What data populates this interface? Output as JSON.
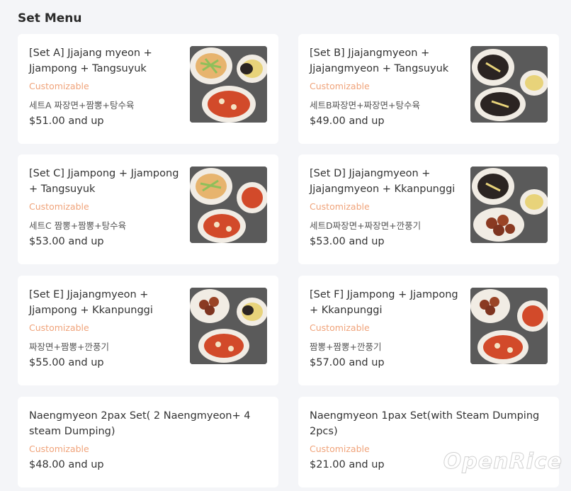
{
  "section_title": "Set Menu",
  "watermark": "OpenRice",
  "colors": {
    "customizable": "#f0a37a",
    "page_bg": "#f4f5f8",
    "card_bg": "#ffffff"
  },
  "items": [
    {
      "name": "[Set A] Jjajang myeon + Jjampong + Tangsuyuk",
      "customizable": "Customizable",
      "desc": "세트A 짜장면+짬뽕+탕수육",
      "price": "$51.00 and up",
      "photo": "set-a-photo"
    },
    {
      "name": "[Set B] Jjajangmyeon + Jjajangmyeon + Tangsuyuk",
      "customizable": "Customizable",
      "desc": "세트B짜장면+짜장면+탕수육",
      "price": "$49.00 and up",
      "photo": "set-b-photo"
    },
    {
      "name": "[Set C] Jjampong + Jjampong + Tangsuyuk",
      "customizable": "Customizable",
      "desc": "세트C 짬뽕+짬뽕+탕수육",
      "price": "$53.00 and up",
      "photo": "set-c-photo"
    },
    {
      "name": "[Set D] Jjajangmyeon + Jjajangmyeon + Kkanpunggi",
      "customizable": "Customizable",
      "desc": "세트D짜장면+짜장면+깐풍기",
      "price": "$53.00 and up",
      "photo": "set-d-photo"
    },
    {
      "name": "[Set E] Jjajangmyeon + Jjampong + Kkanpunggi",
      "customizable": "Customizable",
      "desc": "짜장면+짬뽕+깐풍기",
      "price": "$55.00 and up",
      "photo": "set-e-photo"
    },
    {
      "name": "[Set F] Jjampong + Jjampong + Kkanpunggi",
      "customizable": "Customizable",
      "desc": "짬뽕+짬뽕+깐풍기",
      "price": "$57.00 and up",
      "photo": "set-f-photo"
    },
    {
      "name": "Naengmyeon 2pax Set( 2 Naengmyeon+ 4 steam Dumping)",
      "customizable": "Customizable",
      "price": "$48.00 and up"
    },
    {
      "name": "Naengmyeon 1pax Set(with Steam Dumping 2pcs)",
      "customizable": "Customizable",
      "price": "$21.00 and up"
    }
  ]
}
